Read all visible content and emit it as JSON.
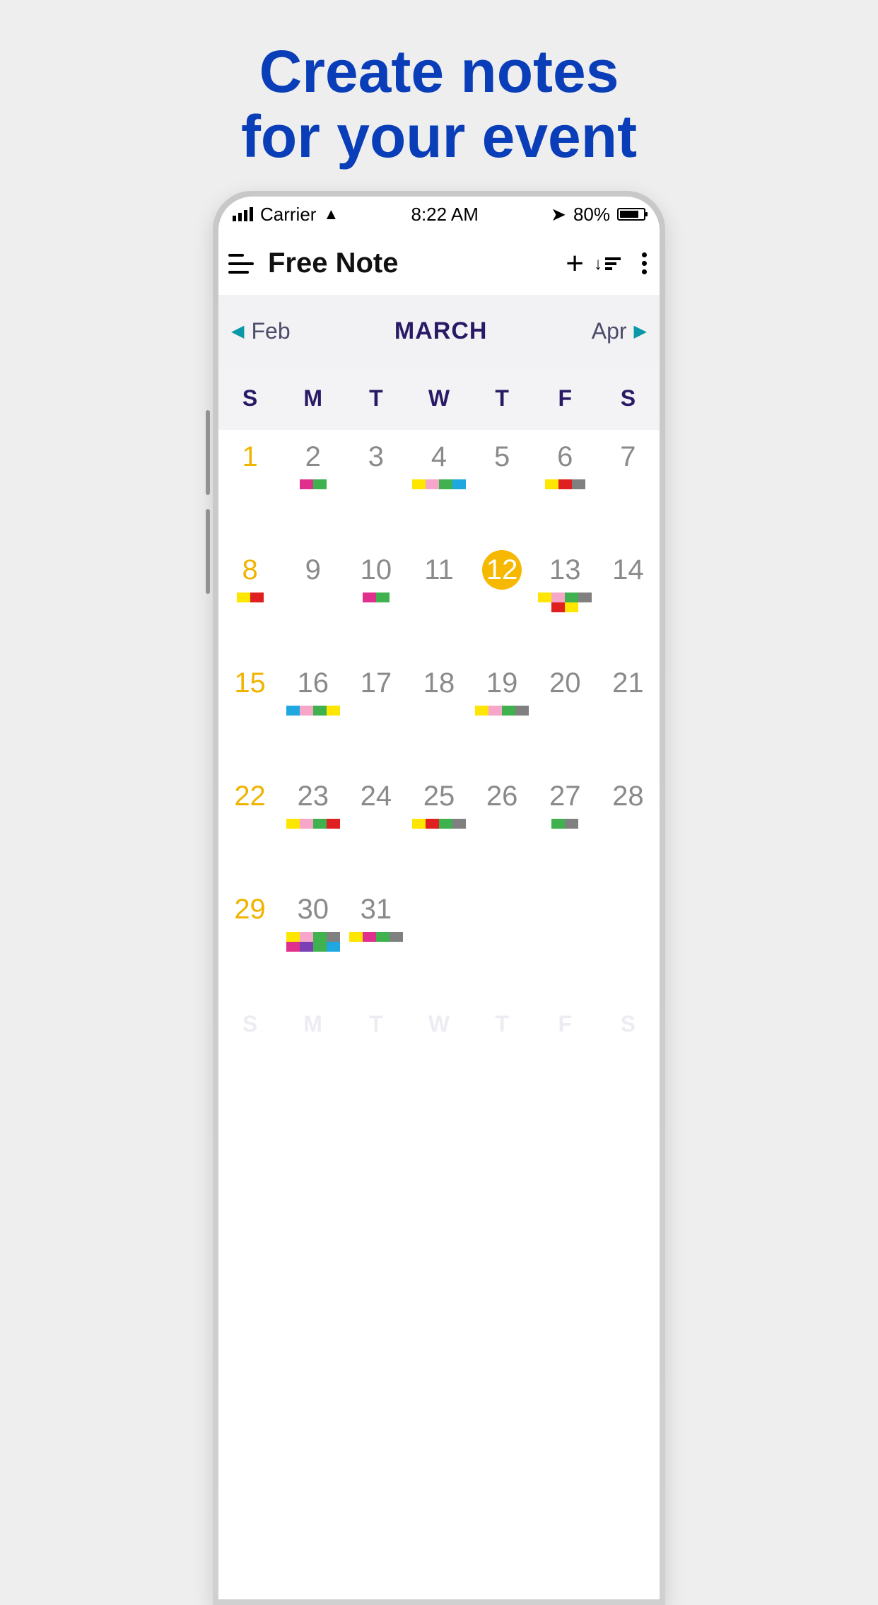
{
  "promo": {
    "line1": "Create notes",
    "line2": "for your event"
  },
  "status": {
    "carrier": "Carrier",
    "time": "8:22 AM",
    "battery": "80%"
  },
  "header": {
    "title": "Free Note"
  },
  "monthNav": {
    "prev": "Feb",
    "current": "MARCH",
    "next": "Apr"
  },
  "weekdays": [
    "S",
    "M",
    "T",
    "W",
    "T",
    "F",
    "S"
  ],
  "colors": {
    "pink": "#e0308d",
    "green": "#3fb24f",
    "yellow": "#ffe600",
    "blue": "#1fa8e0",
    "red": "#e02020",
    "gray": "#808080",
    "lpink": "#f6a6c8",
    "purple": "#7a3fb2"
  },
  "days": [
    {
      "n": 1,
      "sun": true,
      "tags": []
    },
    {
      "n": 2,
      "tags": [
        "pink",
        "green"
      ]
    },
    {
      "n": 3,
      "tags": []
    },
    {
      "n": 4,
      "tags": [
        "yellow",
        "lpink",
        "green",
        "blue"
      ]
    },
    {
      "n": 5,
      "tags": []
    },
    {
      "n": 6,
      "tags": [
        "yellow",
        "red",
        "gray"
      ]
    },
    {
      "n": 7,
      "tags": []
    },
    {
      "n": 8,
      "sun": true,
      "tags": [
        "yellow",
        "red"
      ]
    },
    {
      "n": 9,
      "tags": []
    },
    {
      "n": 10,
      "tags": [
        "pink",
        "green"
      ]
    },
    {
      "n": 11,
      "tags": []
    },
    {
      "n": 12,
      "today": true,
      "tags": []
    },
    {
      "n": 13,
      "tags": [
        "yellow",
        "lpink",
        "green",
        "gray",
        "red",
        "yellow"
      ]
    },
    {
      "n": 14,
      "tags": []
    },
    {
      "n": 15,
      "sun": true,
      "tags": []
    },
    {
      "n": 16,
      "tags": [
        "blue",
        "lpink",
        "green",
        "yellow"
      ]
    },
    {
      "n": 17,
      "tags": []
    },
    {
      "n": 18,
      "tags": []
    },
    {
      "n": 19,
      "tags": [
        "yellow",
        "lpink",
        "green",
        "gray"
      ]
    },
    {
      "n": 20,
      "tags": []
    },
    {
      "n": 21,
      "tags": []
    },
    {
      "n": 22,
      "sun": true,
      "tags": []
    },
    {
      "n": 23,
      "tags": [
        "yellow",
        "lpink",
        "green",
        "red"
      ]
    },
    {
      "n": 24,
      "tags": []
    },
    {
      "n": 25,
      "tags": [
        "yellow",
        "red",
        "green",
        "gray"
      ]
    },
    {
      "n": 26,
      "tags": []
    },
    {
      "n": 27,
      "tags": [
        "green",
        "gray"
      ]
    },
    {
      "n": 28,
      "tags": []
    },
    {
      "n": 29,
      "sun": true,
      "tags": []
    },
    {
      "n": 30,
      "tags": [
        "yellow",
        "lpink",
        "green",
        "gray",
        "pink",
        "purple",
        "green",
        "blue"
      ]
    },
    {
      "n": 31,
      "tags": [
        "yellow",
        "pink",
        "green",
        "gray"
      ]
    }
  ]
}
